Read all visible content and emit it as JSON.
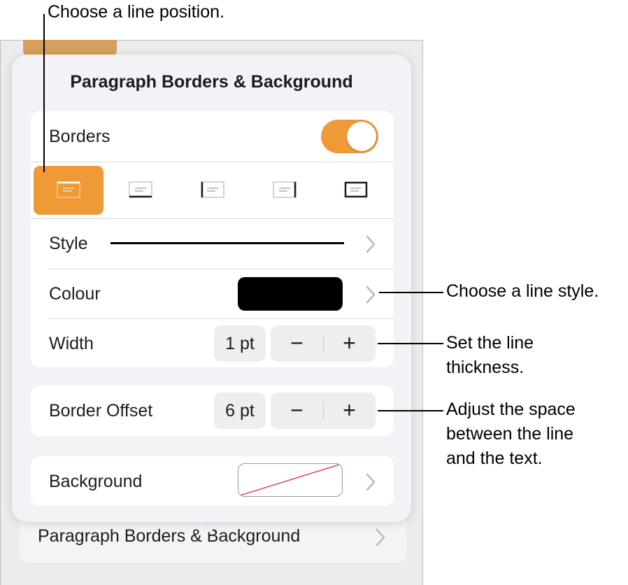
{
  "callouts": {
    "line_position": "Choose a line position.",
    "line_style": "Choose a line style.",
    "thickness_line1": "Set the line",
    "thickness_line2": "thickness.",
    "space_line1": "Adjust the space",
    "space_line2": "between the line",
    "space_line3": "and the text."
  },
  "background_app": {
    "row_label": "Paragraph Borders & Background"
  },
  "popover": {
    "title": "Paragraph Borders & Background",
    "borders": {
      "label": "Borders",
      "toggle_on": true,
      "positions": [
        {
          "name": "top",
          "selected": true
        },
        {
          "name": "bottom",
          "selected": false
        },
        {
          "name": "left",
          "selected": false
        },
        {
          "name": "right",
          "selected": false
        },
        {
          "name": "box",
          "selected": false
        }
      ],
      "style_label": "Style",
      "colour_label": "Colour",
      "colour_value": "#000000",
      "width_label": "Width",
      "width_value": "1 pt"
    },
    "offset": {
      "label": "Border Offset",
      "value": "6 pt"
    },
    "background": {
      "label": "Background"
    },
    "stepper": {
      "minus": "−",
      "plus": "+"
    }
  },
  "colors": {
    "accent": "#f09a37",
    "popover_bg": "#f2f2f7",
    "group_bg": "#ffffff"
  }
}
